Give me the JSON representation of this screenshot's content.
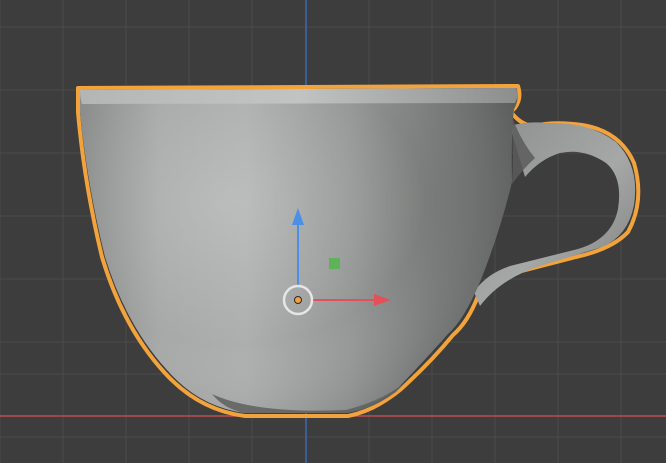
{
  "viewport": {
    "background_color": "#3d3d3d",
    "grid_color": "#4a4a4a",
    "x_axis_color": "#c04a54",
    "z_axis_color": "#3a69b4"
  },
  "object": {
    "name_hint": "teacup-mesh",
    "body_color": "#a3a5a4",
    "selection_outline_color": "#f3a33b",
    "selected": true
  },
  "gizmo": {
    "type": "move-gizmo",
    "x_arrow_color": "#e45057",
    "z_arrow_color": "#4b8fe6",
    "plane_handle_color": "#5fb257",
    "origin_color": "#f2a13a",
    "pivot_ring_color": "#e6e6e6",
    "icons": {
      "x_axis": "arrow-right-icon",
      "z_axis": "arrow-up-icon",
      "plane": "square-handle-icon",
      "pivot": "circle-ring-icon",
      "origin": "origin-dot-icon"
    }
  }
}
